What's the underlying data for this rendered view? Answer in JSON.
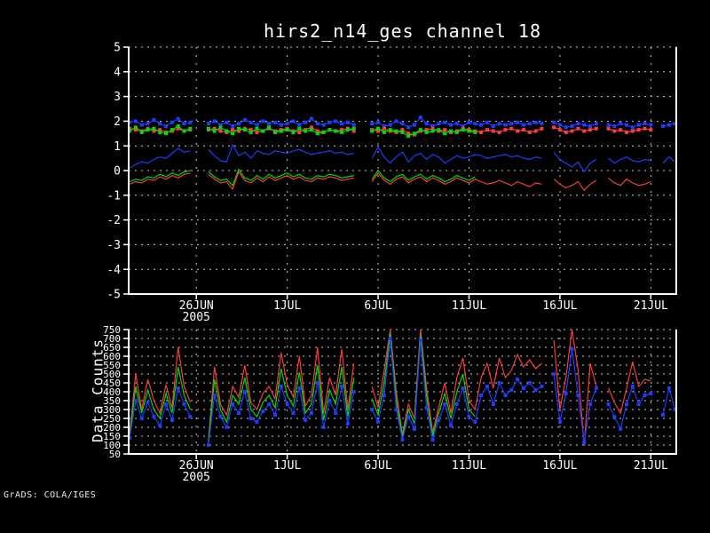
{
  "footer": "GrADS: COLA/IGES",
  "colors": {
    "background": "#000000",
    "axis": "#ffffff",
    "grid": "#c8c8c8",
    "red": "#fa3c3c",
    "green": "#00dc00",
    "blue": "#1e3cff"
  },
  "chart_data": [
    {
      "type": "line",
      "title": "hirs2_n14_ges channel 18",
      "xlabel": "",
      "ylabel": "",
      "x_unit": "days relative to 26JUN2005",
      "grid": true,
      "legend": "none",
      "ylim": [
        -5,
        5
      ],
      "yticks": [
        -5,
        -4,
        -3,
        -2,
        -1,
        0,
        1,
        2,
        3,
        4,
        5
      ],
      "xlim": [
        -3.72,
        26.4
      ],
      "xticks": [
        {
          "v": 0,
          "label": "26JUN",
          "sub": "2005"
        },
        {
          "v": 5,
          "label": "1JUL"
        },
        {
          "v": 10,
          "label": "6JUL"
        },
        {
          "v": 15,
          "label": "11JUL"
        },
        {
          "v": 20,
          "label": "16JUL"
        },
        {
          "v": 25,
          "label": "21JUL"
        }
      ],
      "x0": -3.6667,
      "dx": 0.33333,
      "series": [
        {
          "name": "blue-upper-markers",
          "color": "#1e3cff",
          "markers": true,
          "values": [
            1.95,
            2,
            1.85,
            1.9,
            2.05,
            1.9,
            1.8,
            1.95,
            2.1,
            1.9,
            1.95,
            null,
            null,
            1.9,
            2,
            1.85,
            1.95,
            1.8,
            1.9,
            2.05,
            1.95,
            1.85,
            2,
            1.9,
            1.95,
            1.85,
            1.9,
            2,
            1.85,
            1.95,
            2.1,
            1.9,
            1.85,
            1.95,
            2,
            1.9,
            1.95,
            1.85,
            null,
            null,
            1.9,
            1.95,
            1.8,
            1.85,
            2,
            1.9,
            1.75,
            1.85,
            2.15,
            1.9,
            1.8,
            1.9,
            1.95,
            1.85,
            1.9,
            1.8,
            1.95,
            1.9,
            1.85,
            1.95,
            1.8,
            1.9,
            1.85,
            1.9,
            1.95,
            1.85,
            1.9,
            1.95,
            1.9,
            null,
            1.95,
            1.85,
            1.75,
            1.8,
            1.9,
            1.85,
            1.8,
            1.9,
            null,
            1.85,
            1.8,
            1.9,
            1.85,
            1.75,
            1.85,
            1.9,
            1.85,
            null,
            1.8,
            1.85,
            1.9
          ]
        },
        {
          "name": "red-upper-markers",
          "color": "#fa3c3c",
          "markers": true,
          "values": [
            1.7,
            1.65,
            1.6,
            1.7,
            1.6,
            1.65,
            1.55,
            1.6,
            1.7,
            1.6,
            1.65,
            null,
            null,
            1.65,
            1.7,
            1.6,
            1.55,
            1.65,
            1.6,
            1.7,
            1.65,
            1.55,
            1.6,
            1.7,
            1.6,
            1.65,
            1.7,
            1.6,
            1.55,
            1.65,
            1.75,
            1.6,
            1.55,
            1.65,
            1.6,
            1.65,
            1.7,
            1.6,
            null,
            null,
            1.65,
            1.6,
            1.7,
            1.6,
            1.55,
            1.65,
            1.5,
            1.45,
            1.6,
            1.65,
            1.7,
            1.6,
            1.65,
            1.55,
            1.6,
            1.7,
            1.65,
            1.6,
            1.55,
            1.65,
            1.6,
            1.55,
            1.65,
            1.7,
            1.6,
            1.65,
            1.55,
            1.6,
            1.7,
            null,
            1.75,
            1.65,
            1.55,
            1.6,
            1.7,
            1.6,
            1.65,
            1.7,
            null,
            1.7,
            1.6,
            1.65,
            1.55,
            1.6,
            1.65,
            1.7,
            1.65,
            null,
            null,
            null,
            null
          ]
        },
        {
          "name": "green-upper-markers",
          "color": "#00dc00",
          "markers": true,
          "values": [
            1.6,
            1.75,
            1.55,
            1.65,
            1.7,
            1.55,
            1.5,
            1.65,
            1.8,
            1.6,
            1.7,
            null,
            null,
            1.7,
            1.6,
            1.75,
            1.6,
            1.5,
            1.7,
            1.65,
            1.55,
            1.7,
            1.6,
            1.75,
            1.55,
            1.6,
            1.65,
            1.55,
            1.7,
            1.6,
            1.65,
            1.5,
            1.55,
            1.65,
            1.6,
            1.55,
            1.65,
            1.7,
            null,
            null,
            1.6,
            1.7,
            1.55,
            1.65,
            1.6,
            1.55,
            1.4,
            1.5,
            1.65,
            1.55,
            1.6,
            1.65,
            1.5,
            1.6,
            1.55,
            1.65,
            1.6,
            1.55,
            null,
            null,
            null,
            null,
            null,
            null,
            null,
            null,
            null,
            null,
            null,
            null,
            null,
            null,
            null,
            null,
            null,
            null,
            null,
            null,
            null,
            null,
            null,
            null,
            null,
            null,
            null,
            null,
            null,
            null,
            null,
            null,
            null
          ]
        },
        {
          "name": "blue-mid-line",
          "color": "#1e3cff",
          "markers": false,
          "values": [
            0.1,
            0.25,
            0.35,
            0.3,
            0.45,
            0.55,
            0.5,
            0.7,
            0.9,
            0.75,
            0.8,
            null,
            null,
            0.85,
            0.6,
            0.4,
            0.35,
            1.05,
            0.6,
            0.75,
            0.5,
            0.8,
            0.7,
            0.65,
            0.8,
            0.75,
            0.7,
            0.8,
            0.85,
            0.75,
            0.65,
            0.7,
            0.75,
            0.8,
            0.7,
            0.75,
            0.65,
            0.7,
            null,
            null,
            0.5,
            0.95,
            0.55,
            0.3,
            0.55,
            0.75,
            0.35,
            0.6,
            0.7,
            0.45,
            0.65,
            0.55,
            0.3,
            0.45,
            0.6,
            0.5,
            0.55,
            0.65,
            0.6,
            0.5,
            0.55,
            0.6,
            0.65,
            0.55,
            0.6,
            0.5,
            0.45,
            0.55,
            0.5,
            null,
            0.75,
            0.45,
            0.3,
            0.15,
            0.35,
            -0.05,
            0.3,
            0.45,
            null,
            0.5,
            0.3,
            0.45,
            0.55,
            0.4,
            0.35,
            0.45,
            0.4,
            null,
            0.3,
            0.55,
            0.35
          ]
        },
        {
          "name": "green-lower-line",
          "color": "#00dc00",
          "markers": false,
          "values": [
            -0.45,
            -0.35,
            -0.4,
            -0.25,
            -0.3,
            -0.15,
            -0.25,
            -0.1,
            -0.2,
            -0.05,
            0,
            null,
            null,
            -0.05,
            -0.25,
            -0.4,
            -0.35,
            -0.6,
            0.05,
            -0.3,
            -0.4,
            -0.2,
            -0.35,
            -0.15,
            -0.3,
            -0.2,
            -0.1,
            -0.25,
            -0.15,
            -0.3,
            -0.35,
            -0.2,
            -0.25,
            -0.15,
            -0.2,
            -0.3,
            -0.25,
            -0.2,
            null,
            null,
            -0.35,
            0,
            -0.3,
            -0.45,
            -0.25,
            -0.15,
            -0.4,
            -0.25,
            -0.15,
            -0.35,
            -0.2,
            -0.3,
            -0.45,
            -0.35,
            -0.2,
            -0.3,
            -0.4,
            -0.25,
            null,
            null,
            null,
            null,
            null,
            null,
            null,
            null,
            null,
            null,
            null,
            null,
            null,
            null,
            null,
            null,
            null,
            null,
            null,
            null,
            null,
            null,
            null,
            null,
            null,
            null,
            null,
            null,
            null,
            null,
            null,
            null,
            null
          ]
        },
        {
          "name": "red-lower-line",
          "color": "#fa3c3c",
          "markers": false,
          "values": [
            -0.55,
            -0.45,
            -0.5,
            -0.35,
            -0.4,
            -0.25,
            -0.35,
            -0.2,
            -0.3,
            -0.15,
            -0.1,
            null,
            null,
            -0.15,
            -0.35,
            -0.5,
            -0.45,
            -0.75,
            -0.05,
            -0.4,
            -0.5,
            -0.3,
            -0.45,
            -0.25,
            -0.4,
            -0.3,
            -0.2,
            -0.35,
            -0.25,
            -0.4,
            -0.45,
            -0.3,
            -0.35,
            -0.25,
            -0.3,
            -0.4,
            -0.35,
            -0.3,
            null,
            null,
            -0.45,
            -0.1,
            -0.4,
            -0.55,
            -0.35,
            -0.25,
            -0.5,
            -0.35,
            -0.25,
            -0.45,
            -0.3,
            -0.4,
            -0.55,
            -0.45,
            -0.3,
            -0.4,
            -0.5,
            -0.35,
            -0.45,
            -0.55,
            -0.5,
            -0.4,
            -0.5,
            -0.6,
            -0.45,
            -0.55,
            -0.65,
            -0.5,
            -0.55,
            null,
            -0.35,
            -0.55,
            -0.7,
            -0.6,
            -0.45,
            -0.8,
            -0.55,
            -0.4,
            null,
            -0.3,
            -0.5,
            -0.6,
            -0.35,
            -0.5,
            -0.6,
            -0.55,
            -0.45,
            null,
            null,
            null,
            null
          ]
        }
      ]
    },
    {
      "type": "line",
      "title": "",
      "xlabel": "",
      "ylabel": "Data Counts",
      "x_unit": "days relative to 26JUN2005",
      "grid": true,
      "legend": "none",
      "ylim": [
        50,
        750
      ],
      "yticks": [
        50,
        100,
        150,
        200,
        250,
        300,
        350,
        400,
        450,
        500,
        550,
        600,
        650,
        700,
        750
      ],
      "xlim": [
        -3.72,
        26.4
      ],
      "xticks": [
        {
          "v": 0,
          "label": "26JUN",
          "sub": "2005"
        },
        {
          "v": 5,
          "label": "1JUL"
        },
        {
          "v": 10,
          "label": "6JUL"
        },
        {
          "v": 15,
          "label": "11JUL"
        },
        {
          "v": 20,
          "label": "16JUL"
        },
        {
          "v": 25,
          "label": "21JUL"
        }
      ],
      "x0": -3.6667,
      "dx": 0.33333,
      "series": [
        {
          "name": "red-counts",
          "color": "#fa3c3c",
          "markers": false,
          "values": [
            160,
            500,
            300,
            470,
            350,
            280,
            440,
            310,
            650,
            430,
            340,
            null,
            null,
            130,
            540,
            330,
            270,
            430,
            370,
            550,
            340,
            300,
            390,
            430,
            360,
            620,
            440,
            370,
            600,
            320,
            380,
            650,
            280,
            480,
            380,
            640,
            300,
            560,
            null,
            null,
            430,
            310,
            520,
            750,
            400,
            160,
            330,
            250,
            750,
            420,
            170,
            310,
            450,
            280,
            480,
            590,
            350,
            300,
            480,
            560,
            420,
            590,
            480,
            520,
            610,
            540,
            580,
            530,
            560,
            null,
            690,
            300,
            480,
            750,
            520,
            95,
            560,
            430,
            null,
            420,
            340,
            280,
            420,
            570,
            430,
            470,
            460,
            null,
            null,
            null,
            null
          ]
        },
        {
          "name": "green-counts",
          "color": "#00dc00",
          "markers": false,
          "values": [
            150,
            430,
            280,
            410,
            300,
            250,
            390,
            280,
            540,
            380,
            300,
            null,
            null,
            115,
            470,
            300,
            230,
            380,
            330,
            480,
            300,
            260,
            340,
            380,
            310,
            530,
            380,
            320,
            510,
            280,
            330,
            550,
            240,
            410,
            330,
            540,
            260,
            480,
            null,
            null,
            360,
            270,
            450,
            730,
            350,
            145,
            300,
            220,
            720,
            370,
            150,
            280,
            390,
            250,
            400,
            500,
            300,
            260,
            null,
            null,
            null,
            null,
            null,
            null,
            null,
            null,
            null,
            null,
            null,
            null,
            null,
            null,
            null,
            null,
            null,
            null,
            null,
            null,
            null,
            null,
            null,
            null,
            null,
            null,
            null,
            null,
            null,
            null,
            null,
            null,
            null
          ]
        },
        {
          "name": "blue-counts",
          "color": "#1e3cff",
          "markers": true,
          "values": [
            140,
            350,
            250,
            340,
            260,
            210,
            330,
            240,
            420,
            330,
            260,
            null,
            null,
            100,
            380,
            260,
            200,
            330,
            280,
            400,
            250,
            230,
            290,
            330,
            270,
            430,
            330,
            280,
            420,
            240,
            280,
            450,
            200,
            350,
            280,
            430,
            220,
            400,
            null,
            null,
            300,
            230,
            380,
            700,
            300,
            130,
            260,
            190,
            690,
            310,
            130,
            240,
            330,
            210,
            330,
            420,
            260,
            230,
            380,
            430,
            330,
            450,
            380,
            410,
            470,
            420,
            450,
            410,
            430,
            null,
            500,
            230,
            390,
            640,
            380,
            115,
            330,
            420,
            null,
            330,
            260,
            190,
            330,
            430,
            330,
            380,
            390,
            null,
            270,
            420,
            300
          ]
        }
      ]
    }
  ]
}
